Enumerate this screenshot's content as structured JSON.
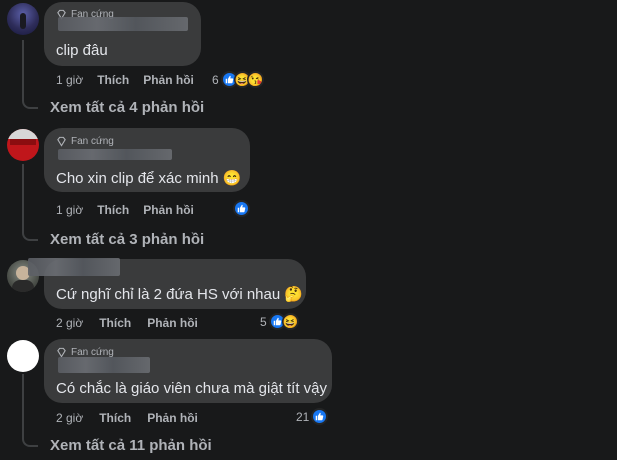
{
  "comments": [
    {
      "badge": "Fan cứng",
      "text": "clip đâu",
      "time": "1 giờ",
      "like": "Thích",
      "reply": "Phản hồi",
      "reactions_count": "6",
      "reaction_icons": [
        "like-icon",
        "grin-squint-icon",
        "kiss-icon"
      ]
    },
    {
      "badge": "Fan cứng",
      "text": "Cho xin clip để xác minh 😁",
      "time": "1 giờ",
      "like": "Thích",
      "reply": "Phản hồi",
      "reactions_count": "",
      "reaction_icons": [
        "like-icon"
      ]
    },
    {
      "badge": "",
      "text": "Cứ nghĩ chỉ là 2 đứa HS với nhau 🤔",
      "time": "2 giờ",
      "like": "Thích",
      "reply": "Phản hồi",
      "reactions_count": "5",
      "reaction_icons": [
        "like-icon",
        "grin-squint-icon"
      ]
    },
    {
      "badge": "Fan cứng",
      "text": "Có chắc là giáo viên chưa mà giật tít vậy",
      "time": "2 giờ",
      "like": "Thích",
      "reply": "Phản hồi",
      "reactions_count": "21",
      "reaction_icons": [
        "like-icon"
      ]
    }
  ],
  "view_more": [
    "Xem tất cả 4 phản hồi",
    "Xem tất cả 3 phản hồi",
    "Xem tất cả 11 phản hồi"
  ],
  "colors": {
    "background": "#18191a",
    "bubble": "#3a3b3c",
    "text": "#e4e6eb",
    "secondary": "#b0b3b8",
    "like": "#1877f2",
    "haha": "#f7b125"
  }
}
